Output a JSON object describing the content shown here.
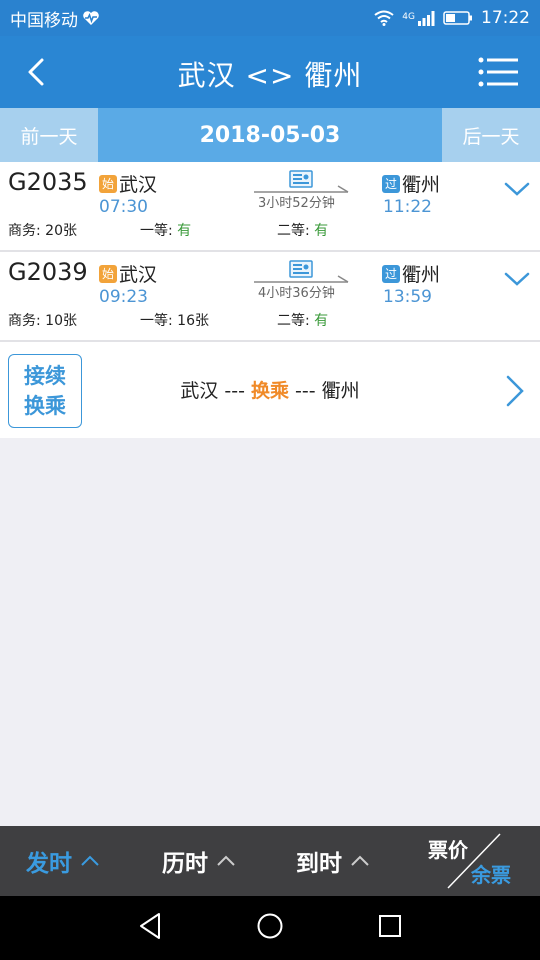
{
  "status_bar": {
    "carrier": "中国移动",
    "time": "17:22",
    "network": "4G"
  },
  "nav": {
    "title": "武汉 <> 衢州"
  },
  "date_bar": {
    "prev": "前一天",
    "date": "2018-05-03",
    "next": "后一天"
  },
  "trains": [
    {
      "number": "G2035",
      "from_badge": "始",
      "from": "武汉",
      "dep_time": "07:30",
      "duration": "3小时52分钟",
      "to_badge": "过",
      "to": "衢州",
      "arr_time": "11:22",
      "biz_label": "商务:",
      "biz_value": "20张",
      "first_label": "一等:",
      "first_value": "有",
      "second_label": "二等:",
      "second_value": "有"
    },
    {
      "number": "G2039",
      "from_badge": "始",
      "from": "武汉",
      "dep_time": "09:23",
      "duration": "4小时36分钟",
      "to_badge": "过",
      "to": "衢州",
      "arr_time": "13:59",
      "biz_label": "商务:",
      "biz_value": "10张",
      "first_label": "一等:",
      "first_value": "16张",
      "second_label": "二等:",
      "second_value": "有"
    }
  ],
  "transfer": {
    "button_line1": "接续",
    "button_line2": "换乘",
    "from": "武汉",
    "sep1": " --- ",
    "middle": "换乘",
    "sep2": " --- ",
    "to": "衢州"
  },
  "sort_bar": {
    "depart": "发时",
    "duration": "历时",
    "arrive": "到时",
    "price": "票价",
    "remaining": "余票",
    "active_color": "#3a9be0"
  }
}
